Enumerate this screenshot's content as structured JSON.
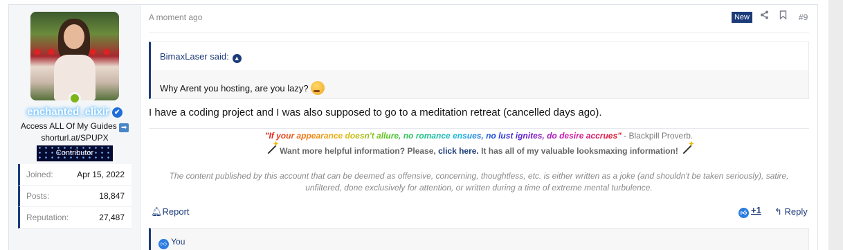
{
  "user": {
    "username": "enchanted_elixir",
    "title_line1": "Access ALL Of My Guides",
    "title_arrow": "➡",
    "title_line2": "shorturl.at/SPUPX",
    "banner": "Contributor",
    "stats": [
      {
        "label": "Joined:",
        "value": "Apr 15, 2022"
      },
      {
        "label": "Posts:",
        "value": "18,847"
      },
      {
        "label": "Reputation:",
        "value": "27,487"
      }
    ]
  },
  "post": {
    "time": "A moment ago",
    "badge": "New",
    "number": "#9",
    "quote": {
      "author": "BimaxLaser said:",
      "text": "Why Arent you hosting, are you lazy?"
    },
    "message": "I have a coding project and I was also supposed to go to a meditation retreat (cancelled days ago).",
    "signature": {
      "quote": "\"If your appearance doesn't allure, no romance ensues, no lust ignites, do desire accrues\"",
      "attribution": " - Blackpill Proverb.",
      "line2_pre": "Want more helpful information? Please, ",
      "line2_link": "click here.",
      "line2_post": " It has all of my valuable looksmaxing information!"
    },
    "disclaimer": "The content published by this account that can be deemed as offensive, concerning, thoughtless, etc. is either written as a joke (and shouldn't be taken seriously), satire, unfiltered, done exclusively for attention, or written during a time of extreme mental turbulence.",
    "actions": {
      "report": "Report",
      "reaction_count": "+1",
      "reply": "Reply"
    },
    "reactions_by": "You"
  },
  "icons": {
    "verified": "verified-badge-icon",
    "share": "share-icon",
    "bookmark": "bookmark-icon",
    "quote_up": "arrow-up-circle-icon",
    "bell": "bell-icon",
    "like": "like-icon",
    "reply": "reply-arrow-icon"
  },
  "colors": {
    "accent": "#1c3b79",
    "online": "#7cb518",
    "like": "#2a7de1"
  }
}
